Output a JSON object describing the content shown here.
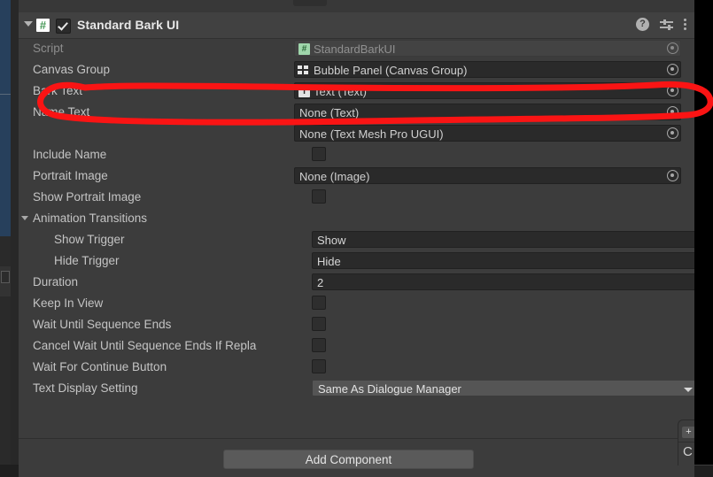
{
  "header": {
    "title": "Standard Bark UI",
    "enabled": true,
    "script_icon": "csharp-script-icon",
    "foldout": "expanded",
    "icons": {
      "help": "?",
      "preset": "preset-icon",
      "menu": "kebab-menu-icon"
    }
  },
  "rows": [
    {
      "label": "Script",
      "type": "object",
      "value": "StandardBarkUI",
      "icon": "script",
      "disabled": true,
      "indent": 1,
      "name": "script"
    },
    {
      "label": "Canvas Group",
      "type": "object",
      "value": "Bubble Panel (Canvas Group)",
      "icon": "canvasgroup",
      "disabled": false,
      "indent": 1,
      "name": "canvas-group"
    },
    {
      "label": "Bark Text",
      "type": "object",
      "value": "Text (Text)",
      "icon": "text",
      "disabled": false,
      "indent": 1,
      "name": "bark-text",
      "highlighted": true
    },
    {
      "label": "Name Text",
      "type": "object",
      "value": "None (Text)",
      "icon": "none",
      "disabled": false,
      "indent": 1,
      "name": "name-text"
    },
    {
      "label": "",
      "type": "object",
      "value": "None (Text Mesh Pro UGUI)",
      "icon": "none",
      "disabled": false,
      "indent": 1,
      "name": "name-text-tmp"
    },
    {
      "label": "Include Name",
      "type": "checkbox",
      "value": false,
      "indent": 1,
      "name": "include-name"
    },
    {
      "label": "Portrait Image",
      "type": "object",
      "value": "None (Image)",
      "icon": "none",
      "disabled": false,
      "indent": 1,
      "name": "portrait-image"
    },
    {
      "label": "Show Portrait Image",
      "type": "checkbox",
      "value": false,
      "indent": 1,
      "name": "show-portrait-image"
    },
    {
      "label": "Animation Transitions",
      "type": "foldout",
      "indent": 1,
      "name": "animation-transitions"
    },
    {
      "label": "Show Trigger",
      "type": "text",
      "value": "Show",
      "indent": 2,
      "name": "show-trigger"
    },
    {
      "label": "Hide Trigger",
      "type": "text",
      "value": "Hide",
      "indent": 2,
      "name": "hide-trigger"
    },
    {
      "label": "Duration",
      "type": "text",
      "value": "2",
      "indent": 1,
      "name": "duration"
    },
    {
      "label": "Keep In View",
      "type": "checkbox",
      "value": false,
      "indent": 1,
      "name": "keep-in-view"
    },
    {
      "label": "Wait Until Sequence Ends",
      "type": "checkbox",
      "value": false,
      "indent": 1,
      "name": "wait-until-sequence-ends"
    },
    {
      "label": "Cancel Wait Until Sequence Ends If Repla",
      "type": "checkbox",
      "value": false,
      "indent": 1,
      "name": "cancel-wait-until-sequence-ends-if-replaced"
    },
    {
      "label": "Wait For Continue Button",
      "type": "checkbox",
      "value": false,
      "indent": 1,
      "name": "wait-for-continue-button"
    },
    {
      "label": "Text Display Setting",
      "type": "dropdown",
      "value": "Same As Dialogue Manager",
      "indent": 1,
      "name": "text-display-setting"
    }
  ],
  "footer": {
    "add_component_label": "Add Component"
  },
  "bottom_right_panel": {
    "plus_label": "+",
    "letter": "C"
  },
  "annotation": {
    "color": "#fa1414",
    "shape": "hand-drawn-ellipse",
    "targets": "Bark Text row"
  },
  "colors": {
    "panel_bg": "#3c3c3c",
    "header_bg": "#414141",
    "field_bg": "#2a2a2a",
    "label": "#c4c4c4",
    "accent_red": "#fa1414",
    "selection_blue": "#27405c"
  }
}
